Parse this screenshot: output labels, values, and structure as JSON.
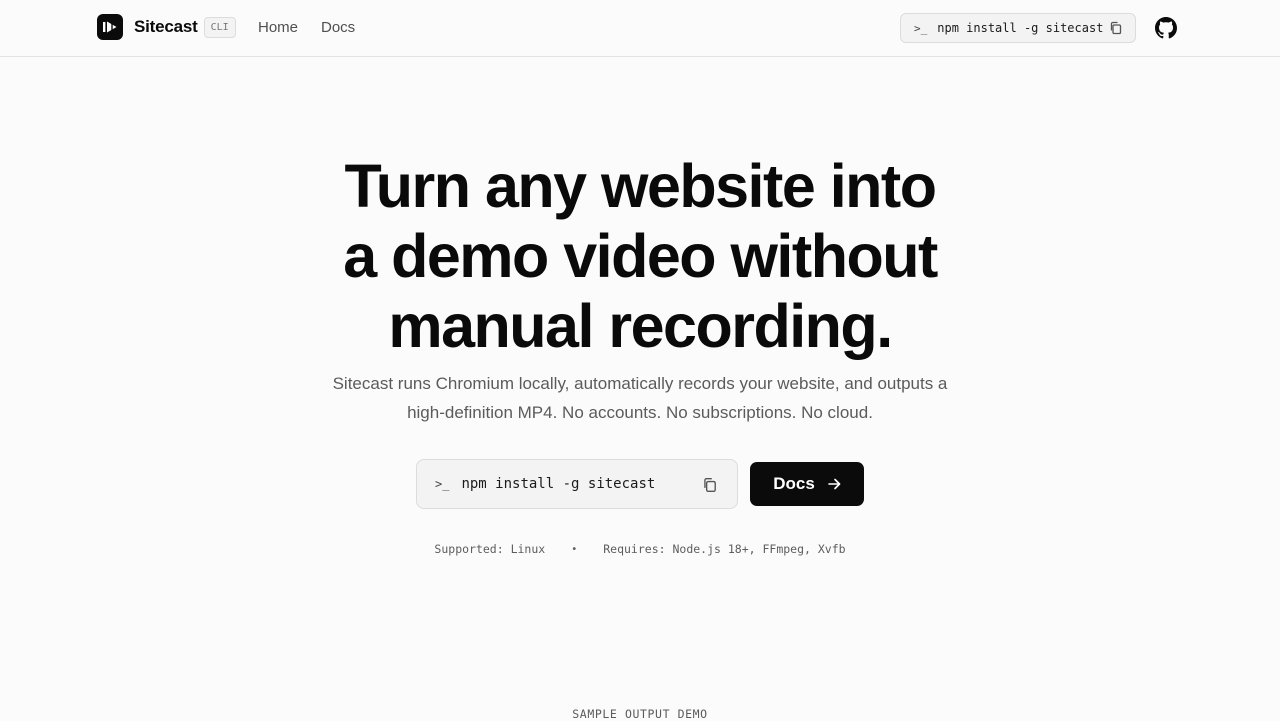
{
  "nav": {
    "brand": "Sitecast",
    "badge": "CLI",
    "links": [
      "Home",
      "Docs"
    ],
    "install_prompt": ">_",
    "install_command": "npm install -g sitecast",
    "icons": {
      "logo": "play-logo-icon",
      "copy": "copy-icon",
      "github": "github-icon"
    }
  },
  "hero": {
    "title_lines": [
      "Turn any website into",
      "a demo video without",
      "manual recording."
    ],
    "subtitle_lines": [
      "Sitecast runs Chromium locally, automatically records your website, and outputs a",
      "high-definition MP4. No accounts. No subscriptions. No cloud."
    ],
    "install_prompt": ">_",
    "install_command": "npm install -g sitecast",
    "docs_button": "Docs",
    "supported": "Supported: Linux",
    "separator": "•",
    "requires": "Requires: Node.js 18+, FFmpeg, Xvfb"
  },
  "sample": {
    "label": "SAMPLE OUTPUT DEMO"
  },
  "colors": {
    "background": "#fbfbfb",
    "text": "#0b0b0b",
    "muted": "#5b5b5b",
    "button": "#0b0b0b"
  }
}
